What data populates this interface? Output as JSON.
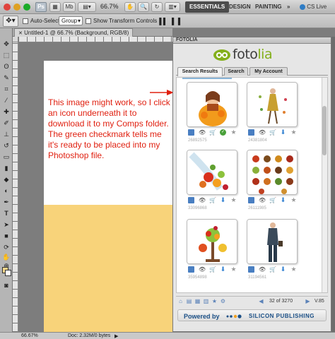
{
  "app": {
    "ps_badge": "Ps",
    "zoom_level": "66.7%",
    "mb_label": "Mb",
    "workspaces": [
      "ESSENTIALS",
      "DESIGN",
      "PAINTING"
    ],
    "more_label": "»",
    "cs_live": "CS Live"
  },
  "options_bar": {
    "auto_select_label": "Auto-Select:",
    "auto_select_value": "Group",
    "show_transform_label": "Show Transform Controls"
  },
  "document": {
    "tab_title": "Untitled-1 @ 66.7% (Background, RGB/8)"
  },
  "canvas": {
    "annotation": "This image might work, so I click an icon underneath it to download it to my Comps folder. The green checkmark tells me it's ready to be placed into my Photoshop file.",
    "annotation_color": "#e02010",
    "yellow_color": "#f8d37a"
  },
  "status_bar": {
    "zoom": "66.67%",
    "doc_info": "Doc: 2.32M/0 bytes"
  },
  "panel": {
    "header": "FOTOLIA",
    "logo_text_a": "foto",
    "logo_text_b": "lia",
    "tabs": [
      "Search Results",
      "Search",
      "My Account"
    ],
    "results": [
      {
        "id": "26892575",
        "downloaded": true
      },
      {
        "id": "24381804",
        "downloaded": false
      },
      {
        "id": "33096868",
        "downloaded": false
      },
      {
        "id": "26111985",
        "downloaded": false
      },
      {
        "id": "35954898",
        "downloaded": false
      },
      {
        "id": "31194561",
        "downloaded": false
      }
    ],
    "pager_count": "32 of 3270",
    "version": "V.85",
    "powered_by": "Powered by",
    "publisher": "SILICON PUBLISHING"
  }
}
